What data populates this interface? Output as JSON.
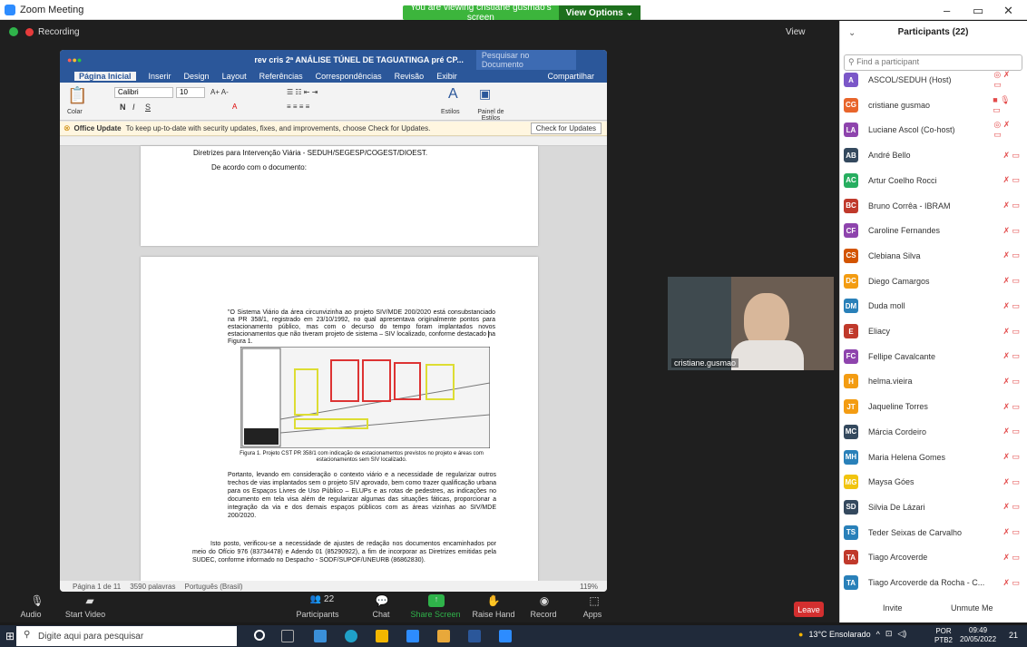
{
  "window": {
    "title": "Zoom Meeting",
    "minimize": "–",
    "restore": "▭",
    "close": "✕"
  },
  "banner": {
    "message": "You are viewing cristiane gusmao's screen",
    "view_options": "View Options ⌄"
  },
  "recording_label": "Recording",
  "view_label": "View",
  "word": {
    "title": "rev cris 2ª ANÁLISE TÚNEL DE TAGUATINGA pré CP...",
    "search_placeholder": "Pesquisar no Documento",
    "tabs": [
      "Página Inicial",
      "Inserir",
      "Design",
      "Layout",
      "Referências",
      "Correspondências",
      "Revisão",
      "Exibir"
    ],
    "share_label": "Compartilhar",
    "font_name": "Calibri",
    "font_size": "10",
    "paste_label": "Colar",
    "styles_label": "Estilos",
    "styles_pane_label": "Painel de Estilos",
    "update_title": "Office Update",
    "update_text": "To keep up-to-date with security updates, fixes, and improvements, choose Check for Updates.",
    "update_button": "Check for Updates",
    "page1_line1": "Diretrizes para Intervenção Viária - SEDUH/SEGESP/COGEST/DIOEST.",
    "page1_line2": "De acordo com o documento:",
    "quote": "\"O Sistema Viário da área circunvizinha ao projeto SIV/MDE 200/2020 está consubstanciado na PR 358/1, registrado em 23/10/1992, no qual apresentava originalmente pontos para estacionamento público, mas com o decurso do tempo foram implantados novos estacionamentos que não tiveram projeto de sistema – SIV localizado, conforme destacado na Figura 1.",
    "figure_caption": "Figura 1. Projeto CST PR 358/1 com indicação de estacionamentos previstos no projeto e áreas com estacionamentos sem SIV localizado.",
    "para1": "Portanto, levando em consideração o contexto viário e a necessidade de regularizar outros trechos de vias implantados sem o projeto SIV aprovado, bem como trazer qualificação urbana para os Espaços Livres de Uso Público – ELUPs e as rotas de pedestres, as indicações no documento em tela visa além de regularizar algumas das situações fáticas, proporcionar a integração da via e dos demais espaços públicos com as áreas vizinhas ao SIV/MDE 200/2020.",
    "para2": "Isto posto, verificou-se a necessidade de ajustes de redação nos documentos encaminhados por meio do Ofício 976 (83734478) e Adendo 01 (85290922), a fim de incorporar as Diretrizes emitidas pela SUDEC, conforme informado no Despacho - SODF/SUPOF/UNEURB (86862830).",
    "status_page": "Página 1 de 11",
    "status_words": "3590 palavras",
    "status_lang": "Português (Brasil)",
    "zoom": "119%"
  },
  "video": {
    "name": "cristiane.gusmao"
  },
  "participants": {
    "title": "Participants (22)",
    "search_placeholder": "Find a participant",
    "list": [
      {
        "initials": "A",
        "name": "ASCOL/SEDUH (Host)",
        "color": "#7b57c8"
      },
      {
        "initials": "CG",
        "name": "cristiane gusmao",
        "color": "#e8652b"
      },
      {
        "initials": "LA",
        "name": "Luciane Ascol (Co-host)",
        "color": "#8e44ad"
      },
      {
        "initials": "AB",
        "name": "André Bello",
        "color": "#34495e"
      },
      {
        "initials": "AC",
        "name": "Artur Coelho Rocci",
        "color": "#27ae60"
      },
      {
        "initials": "BC",
        "name": "Bruno Corrêa - IBRAM",
        "color": "#c0392b"
      },
      {
        "initials": "CF",
        "name": "Caroline Fernandes",
        "color": "#8e44ad"
      },
      {
        "initials": "CS",
        "name": "Clebiana Silva",
        "color": "#d35400"
      },
      {
        "initials": "DC",
        "name": "Diego Camargos",
        "color": "#f39c12"
      },
      {
        "initials": "DM",
        "name": "Duda moll",
        "color": "#2980b9"
      },
      {
        "initials": "E",
        "name": "Eliacy",
        "color": "#c0392b"
      },
      {
        "initials": "FC",
        "name": "Fellipe Cavalcante",
        "color": "#8e44ad"
      },
      {
        "initials": "H",
        "name": "helma.vieira",
        "color": "#f39c12"
      },
      {
        "initials": "JT",
        "name": "Jaqueline Torres",
        "color": "#f39c12"
      },
      {
        "initials": "MC",
        "name": "Márcia Cordeiro",
        "color": "#34495e"
      },
      {
        "initials": "MH",
        "name": "Maria Helena Gomes",
        "color": "#2980b9"
      },
      {
        "initials": "MG",
        "name": "Maysa Góes",
        "color": "#f1c40f"
      },
      {
        "initials": "SD",
        "name": "Silvia De Lázari",
        "color": "#34495e"
      },
      {
        "initials": "TS",
        "name": "Teder Seixas de Carvalho",
        "color": "#2980b9"
      },
      {
        "initials": "TA",
        "name": "Tiago Arcoverde",
        "color": "#c0392b"
      },
      {
        "initials": "TA",
        "name": "Tiago Arcoverde da Rocha - C...",
        "color": "#2980b9"
      }
    ],
    "invite": "Invite",
    "unmute": "Unmute Me"
  },
  "toolbar": {
    "audio": "Audio",
    "start_video": "Start Video",
    "participants": "Participants",
    "participant_count": "22",
    "chat": "Chat",
    "share_screen": "Share Screen",
    "raise_hand": "Raise Hand",
    "record": "Record",
    "apps": "Apps",
    "leave": "Leave"
  },
  "taskbar": {
    "search_placeholder": "Digite aqui para pesquisar",
    "weather": "13°C Ensolarado",
    "lang": "POR",
    "lang2": "PTB2",
    "time": "09:49",
    "date": "20/05/2022",
    "notif_count": "21"
  }
}
